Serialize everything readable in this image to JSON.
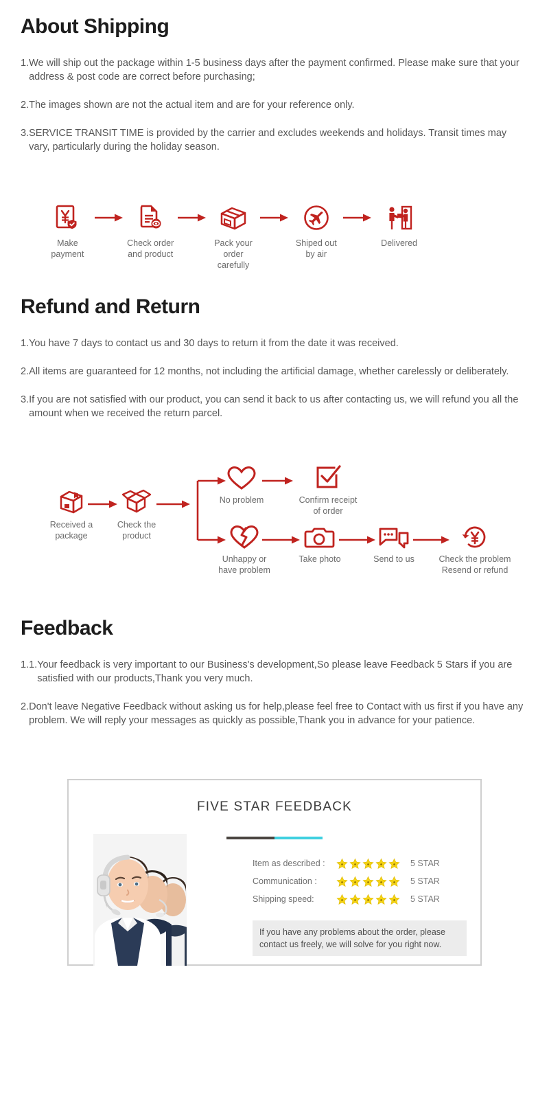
{
  "sections": {
    "shipping": {
      "title": "About Shipping",
      "items": [
        {
          "num": "1.",
          "text": "We will ship out the package within 1-5 business days after the payment confirmed. Please make sure that your address & post code are correct before purchasing;"
        },
        {
          "num": "2.",
          "text": "The images shown are not the actual item and are for your reference only."
        },
        {
          "num": "3.",
          "text": "SERVICE TRANSIT TIME is provided by the carrier and excludes weekends and holidays. Transit times may vary, particularly during the holiday season."
        }
      ]
    },
    "refund": {
      "title": "Refund and Return",
      "items": [
        {
          "num": "1.",
          "text": "You have 7 days to contact us and 30 days to return it from the date it was received."
        },
        {
          "num": "2.",
          "text": "All items are guaranteed for 12 months, not including the artificial damage, whether carelessly or deliberately."
        },
        {
          "num": "3.",
          "text": "If you are not satisfied with our product, you can send it back to us after contacting us, we will refund you all the amount when we received the return parcel."
        }
      ]
    },
    "feedback": {
      "title": "Feedback",
      "items": [
        {
          "num": "1.1.",
          "text": "Your feedback is very important to our Business's development,So please leave Feedback 5 Stars if you are satisfied with our products,Thank you very much."
        },
        {
          "num": "2.",
          "text": "Don't leave Negative Feedback without asking us for help,please feel free to Contact with us first if you have any problem. We will reply your messages as quickly as possible,Thank you in advance for your patience."
        }
      ]
    }
  },
  "shipping_flow": {
    "steps": [
      {
        "icon": "payment-receipt-icon",
        "label": "Make payment"
      },
      {
        "icon": "document-check-icon",
        "label": "Check order\nand product"
      },
      {
        "icon": "package-box-icon",
        "label": "Pack your\norder carefully"
      },
      {
        "icon": "airplane-circle-icon",
        "label": "Shiped out\nby air"
      },
      {
        "icon": "delivery-person-icon",
        "label": "Delivered"
      }
    ],
    "arrow_icon": "arrow-right-icon"
  },
  "return_flow": {
    "nodes": [
      {
        "icon": "closed-box-icon",
        "label": "Received a\npackage"
      },
      {
        "icon": "open-box-icon",
        "label": "Check the\nproduct"
      },
      {
        "icon": "heart-icon",
        "label": "No problem"
      },
      {
        "icon": "checkbox-check-icon",
        "label": "Confirm receipt\nof order"
      },
      {
        "icon": "broken-heart-icon",
        "label": "Unhappy or\nhave problem"
      },
      {
        "icon": "camera-icon",
        "label": "Take photo"
      },
      {
        "icon": "chat-bubbles-icon",
        "label": "Send to us"
      },
      {
        "icon": "refund-yen-icon",
        "label": "Check the problem\nResend or refund"
      }
    ],
    "arrow_icon": "arrow-right-icon",
    "branch_icon": "branch-split-icon"
  },
  "feedback_card": {
    "title": "FIVE STAR FEEDBACK",
    "divider_colors": {
      "left": "#4a4540",
      "right": "#3fd0e0"
    },
    "photo": {
      "name": "customer-service-agents-photo",
      "alt": "Three call center agents wearing headsets"
    },
    "ratings": [
      {
        "label": "Item as described :",
        "stars": 5,
        "value": "5 STAR"
      },
      {
        "label": "Communication :",
        "stars": 5,
        "value": "5 STAR"
      },
      {
        "label": "Shipping speed:",
        "stars": 5,
        "value": "5 STAR"
      }
    ],
    "star_color": "#f5d312",
    "note": "If you have any problems about the order, please contact us freely, we will solve for you right now."
  },
  "theme": {
    "accent_red": "#c0231f",
    "heading_color": "#1d1d1d",
    "body_color": "#565656",
    "label_color": "#6b6b6b"
  }
}
